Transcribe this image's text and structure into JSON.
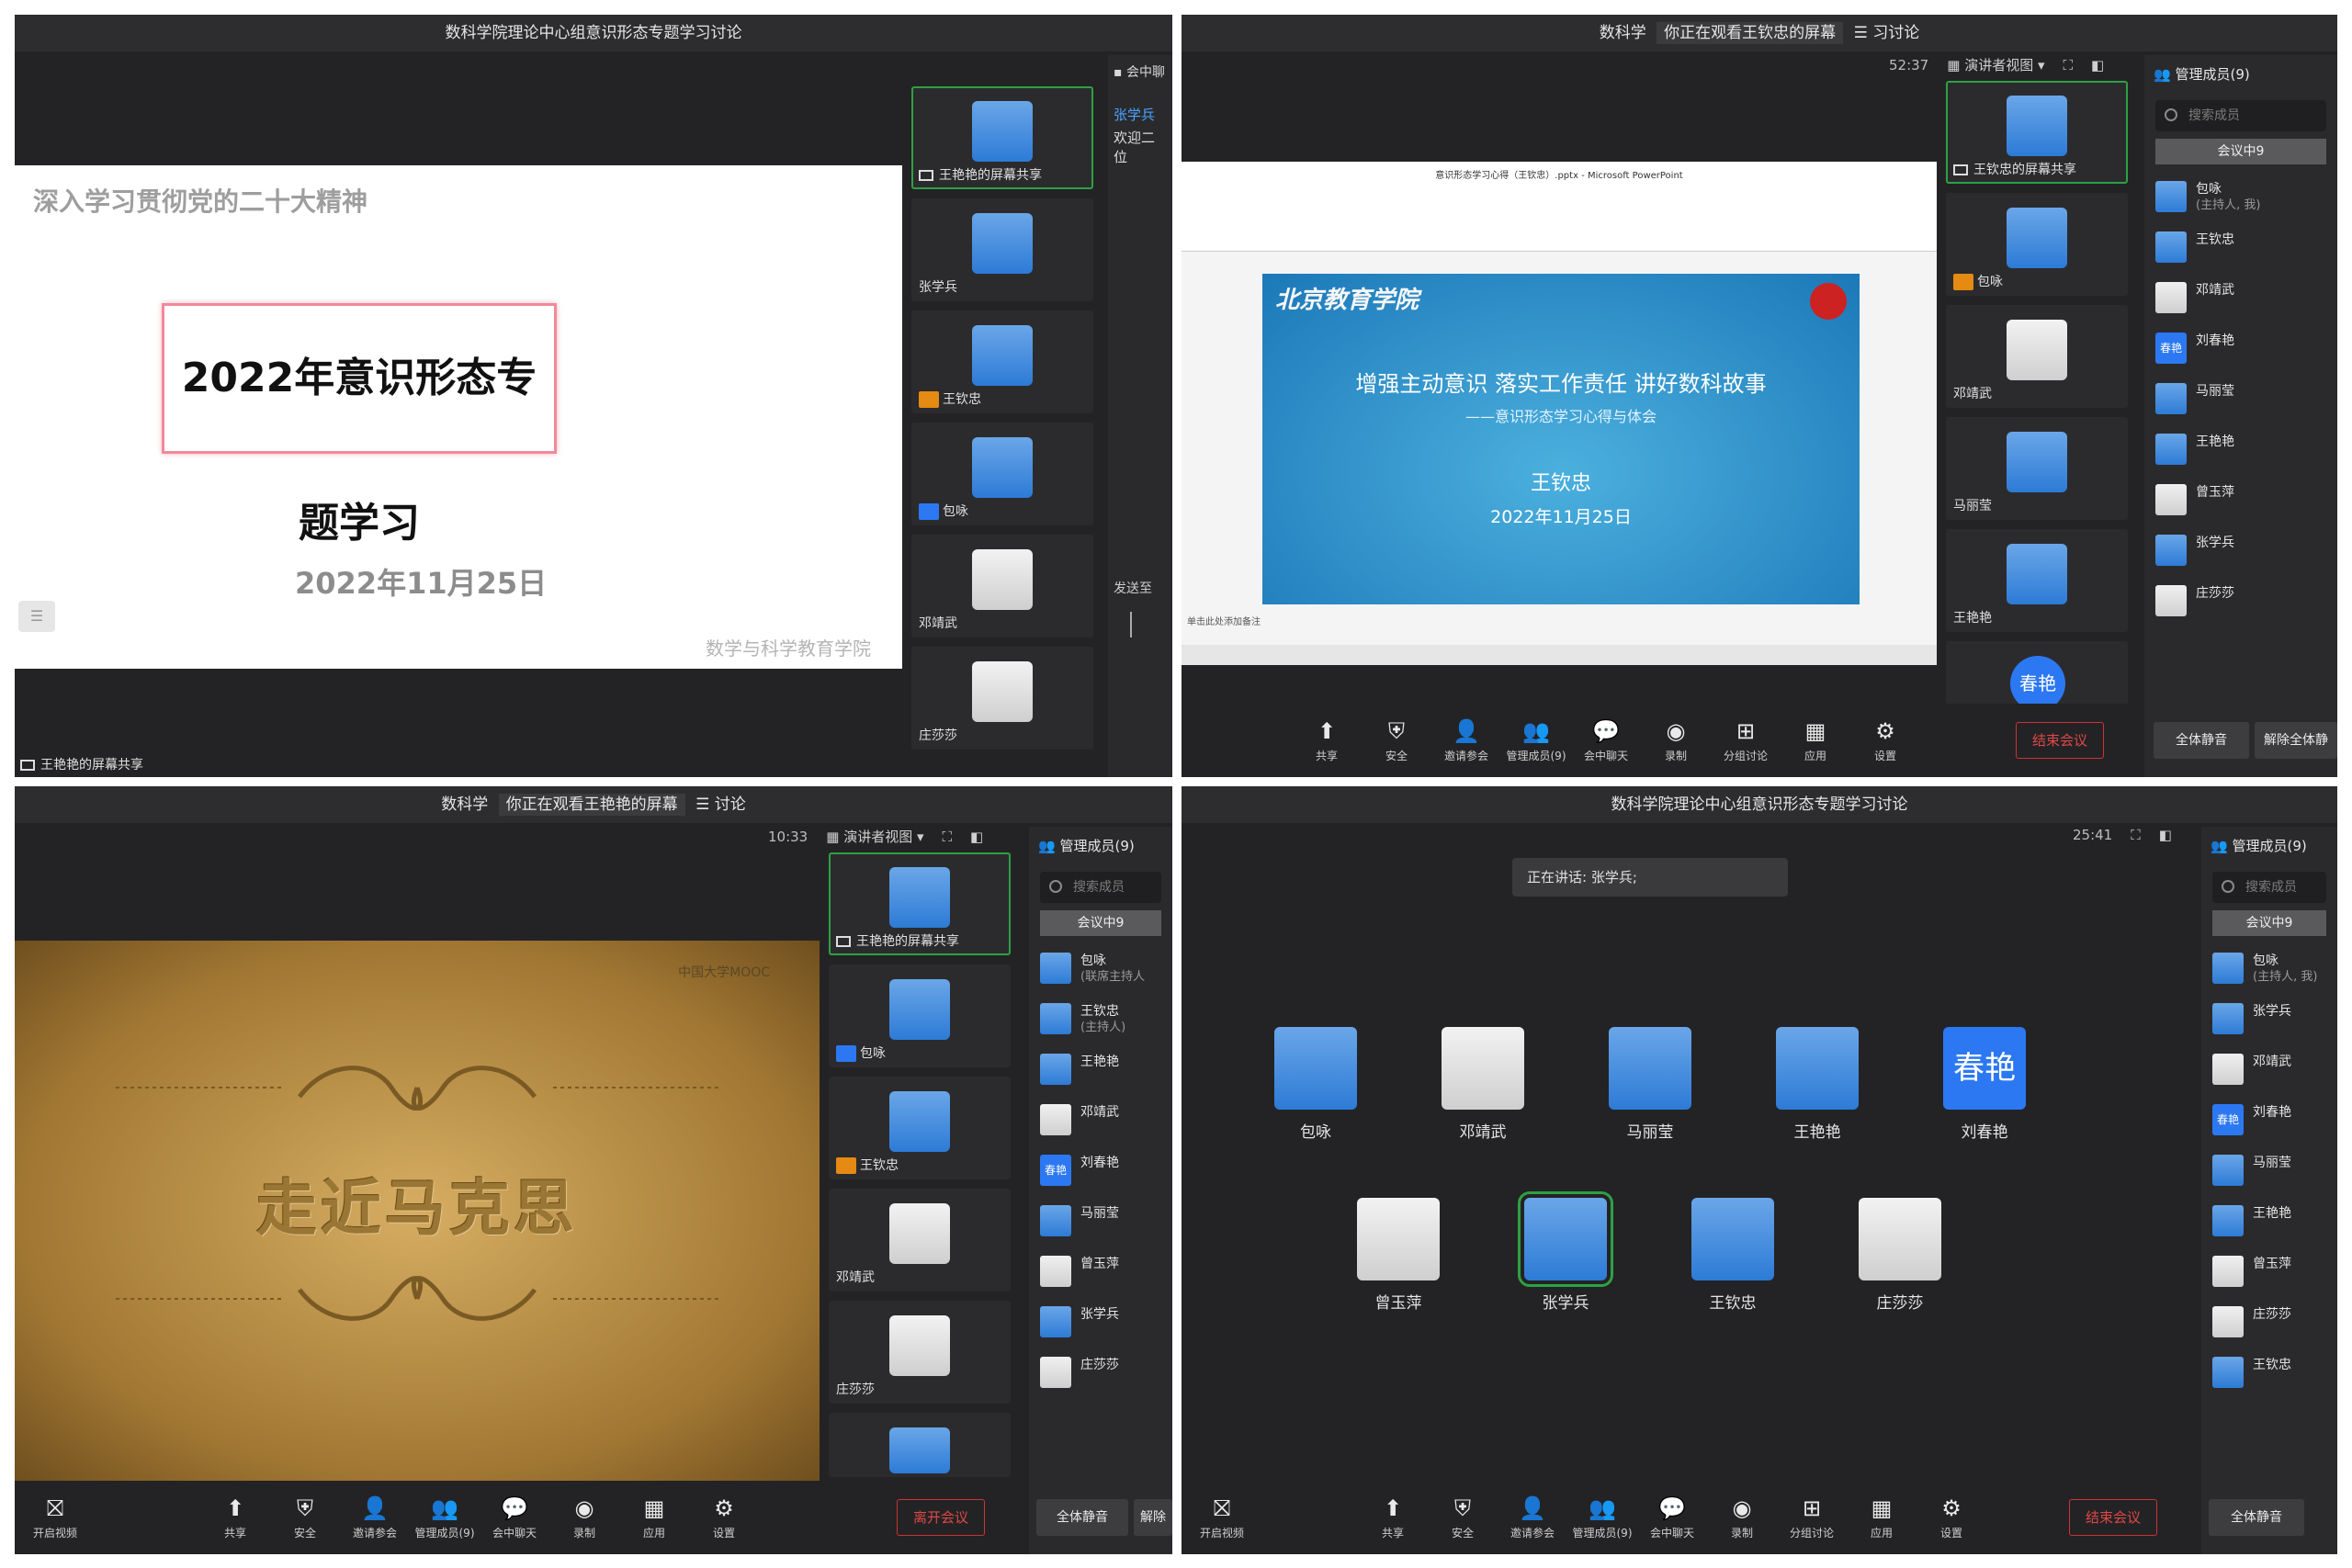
{
  "q1": {
    "title": "数科学院理论中心组意识形态专题学习讨论",
    "chat_header": "会中聊",
    "chat_name": "张学兵",
    "chat_msg": "欢迎二位",
    "send_to": "发送至",
    "share_label": "王艳艳的屏幕共享",
    "slide": {
      "heading": "深入学习贯彻党的二十大精神",
      "main": "2022年意识形态专题学习",
      "date": "2022年11月25日",
      "org": "数学与科学教育学院"
    },
    "tiles": [
      "王艳艳的屏幕共享",
      "张学兵",
      "王钦忠",
      "包咏",
      "邓靖武",
      "庄莎莎"
    ]
  },
  "q2": {
    "title_left": "数科学",
    "title_mid": "你正在观看王钦忠的屏幕",
    "title_right": "习讨论",
    "timer": "52:37",
    "view_mode": "演讲者视图",
    "members_header": "管理成员(9)",
    "search_placeholder": "搜索成员",
    "tab": "会议中9",
    "members": [
      {
        "name": "包咏",
        "sub": "(主持人, 我)"
      },
      {
        "name": "王钦忠",
        "sub": ""
      },
      {
        "name": "邓靖武",
        "sub": ""
      },
      {
        "name": "刘春艳",
        "sub": ""
      },
      {
        "name": "马丽莹",
        "sub": ""
      },
      {
        "name": "王艳艳",
        "sub": ""
      },
      {
        "name": "曾玉萍",
        "sub": ""
      },
      {
        "name": "张学兵",
        "sub": ""
      },
      {
        "name": "庄莎莎",
        "sub": ""
      }
    ],
    "tiles": [
      "王钦忠的屏幕共享",
      "包咏",
      "邓靖武",
      "马丽莹",
      "王艳艳",
      "春艳"
    ],
    "ppt": {
      "window_title": "意识形态学习心得（王钦忠）.pptx - Microsoft PowerPoint",
      "logo": "北京教育学院",
      "line1": "增强主动意识  落实工作责任  讲好数科故事",
      "line2": "——意识形态学习心得与体会",
      "line3": "王钦忠",
      "line4": "2022年11月25日",
      "notes": "单击此处添加备注"
    },
    "toolbar": [
      "共享",
      "安全",
      "邀请参会",
      "管理成员(9)",
      "会中聊天",
      "录制",
      "分组讨论",
      "应用",
      "设置"
    ],
    "end": "结束会议",
    "mute_all": "全体静音",
    "unmute_all": "解除全体静"
  },
  "q3": {
    "title_left": "数科学",
    "title_mid": "你正在观看王艳艳的屏幕",
    "title_right": "讨论",
    "timer": "10:33",
    "view_mode": "演讲者视图",
    "members_header": "管理成员(9)",
    "search_placeholder": "搜索成员",
    "tab": "会议中9",
    "members": [
      {
        "name": "包咏",
        "sub": "(联席主持人"
      },
      {
        "name": "王钦忠",
        "sub": "(主持人)"
      },
      {
        "name": "王艳艳",
        "sub": ""
      },
      {
        "name": "邓靖武",
        "sub": ""
      },
      {
        "name": "刘春艳",
        "sub": ""
      },
      {
        "name": "马丽莹",
        "sub": ""
      },
      {
        "name": "曾玉萍",
        "sub": ""
      },
      {
        "name": "张学兵",
        "sub": ""
      },
      {
        "name": "庄莎莎",
        "sub": ""
      }
    ],
    "tiles": [
      "王艳艳的屏幕共享",
      "包咏",
      "王钦忠",
      "邓靖武",
      "庄莎莎"
    ],
    "slide": {
      "main": "走近马克思",
      "watermark": "中国大学MOOC"
    },
    "open_video": "开启视频",
    "toolbar": [
      "共享",
      "安全",
      "邀请参会",
      "管理成员(9)",
      "会中聊天",
      "录制",
      "应用",
      "设置"
    ],
    "leave": "离开会议",
    "mute_all": "全体静音",
    "unmute": "解除"
  },
  "q4": {
    "title": "数科学院理论中心组意识形态专题学习讨论",
    "timer": "25:41",
    "members_header": "管理成员(9)",
    "search_placeholder": "搜索成员",
    "tab": "会议中9",
    "speaking": "正在讲话: 张学兵;",
    "members": [
      {
        "name": "包咏",
        "sub": "(主持人, 我)"
      },
      {
        "name": "张学兵",
        "sub": ""
      },
      {
        "name": "邓靖武",
        "sub": ""
      },
      {
        "name": "刘春艳",
        "sub": ""
      },
      {
        "name": "马丽莹",
        "sub": ""
      },
      {
        "name": "王艳艳",
        "sub": ""
      },
      {
        "name": "曾玉萍",
        "sub": ""
      },
      {
        "name": "庄莎莎",
        "sub": ""
      },
      {
        "name": "王钦忠",
        "sub": ""
      }
    ],
    "grid": [
      "包咏",
      "邓靖武",
      "马丽莹",
      "王艳艳",
      "刘春艳",
      "曾玉萍",
      "张学兵",
      "王钦忠",
      "庄莎莎"
    ],
    "avatar_text": "春艳",
    "open_video": "开启视频",
    "toolbar": [
      "共享",
      "安全",
      "邀请参会",
      "管理成员(9)",
      "会中聊天",
      "录制",
      "分组讨论",
      "应用",
      "设置"
    ],
    "end": "结束会议",
    "mute_all": "全体静音"
  }
}
